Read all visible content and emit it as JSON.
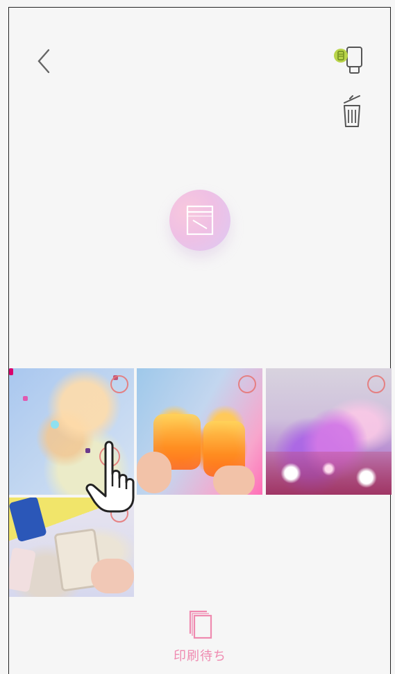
{
  "icons": {
    "back": "chevron-left-icon",
    "printer": "printer-status-icon",
    "trash": "trash-icon",
    "print": "print-icon",
    "queue": "print-queue-icon",
    "selection": "selection-ring-icon",
    "hand": "hand-pointer-icon"
  },
  "colors": {
    "background": "#f6f6f6",
    "accent_pink": "#ef8ab0",
    "printer_battery": "#b9d44a",
    "selection_ring": "#e67878"
  },
  "gallery": {
    "items": [
      {
        "id": "photo-1",
        "subject": "confetti-hair-photo",
        "selected": false
      },
      {
        "id": "photo-2",
        "subject": "jar-drinks-photo",
        "selected": false
      },
      {
        "id": "photo-3",
        "subject": "glitter-photo",
        "selected": false
      },
      {
        "id": "photo-4",
        "subject": "letter-blocks-photo",
        "selected": false
      }
    ]
  },
  "bottom_bar": {
    "queue_label": "印刷待ち"
  }
}
